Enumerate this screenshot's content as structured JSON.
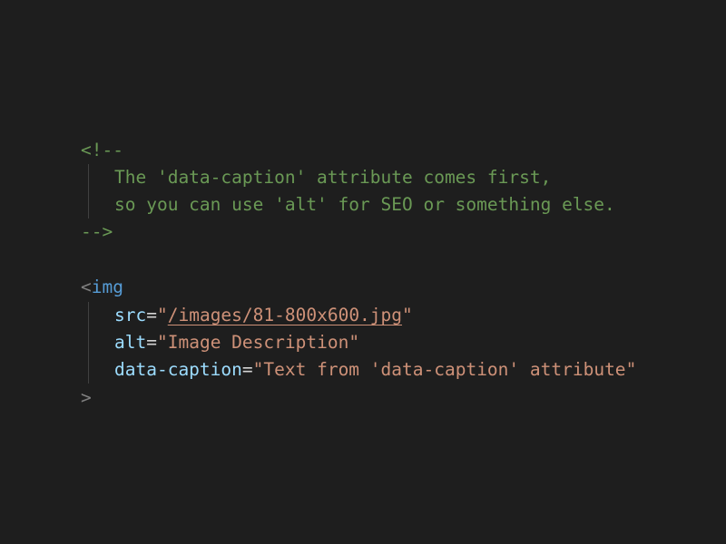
{
  "code": {
    "comment_open": "<!--",
    "comment_line_1": "The 'data-caption' attribute comes first,",
    "comment_line_2": "so you can use 'alt' for SEO or something else.",
    "comment_close": "-->",
    "tag_open_bracket": "<",
    "tag_name": "img",
    "attributes": [
      {
        "name": "src",
        "eq": "=",
        "quote": "\"",
        "value": "/images/81-800x600.jpg"
      },
      {
        "name": "alt",
        "eq": "=",
        "quote": "\"",
        "value": "Image Description"
      },
      {
        "name": "data-caption",
        "eq": "=",
        "quote": "\"",
        "value": "Text from 'data-caption' attribute"
      }
    ],
    "tag_close_bracket": ">"
  },
  "colors": {
    "background": "#1e1e1e",
    "comment": "#6a9955",
    "tag": "#569cd6",
    "attribute": "#9cdcfe",
    "string": "#ce9178",
    "punctuation": "#808080"
  }
}
